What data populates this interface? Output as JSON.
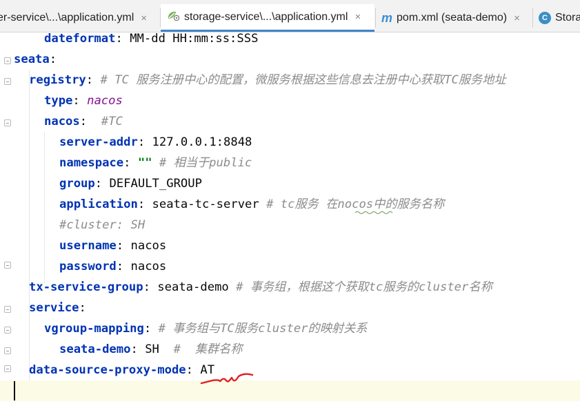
{
  "tabs": [
    {
      "label": "er-service\\...\\application.yml",
      "active": false
    },
    {
      "label": "storage-service\\...\\application.yml",
      "active": true
    },
    {
      "label": "pom.xml (seata-demo)",
      "active": false
    },
    {
      "label": "Stora",
      "active": false
    }
  ],
  "tab_icons": {
    "m_letter": "m",
    "c_letter": "C"
  },
  "close_glyph": "×",
  "lines": [
    {
      "key": "dateformat",
      "sep": ": ",
      "value": "MM-dd HH:mm:ss:SSS"
    },
    {
      "key": "seata",
      "sep": ":"
    },
    {
      "key": "registry",
      "sep": ": ",
      "comment": "# TC 服务注册中心的配置，微服务根据这些信息去注册中心获取TC服务地址"
    },
    {
      "key": "type",
      "sep": ": ",
      "value": "nacos"
    },
    {
      "key": "nacos",
      "sep": ":  ",
      "comment": "#TC"
    },
    {
      "key": "server-addr",
      "sep": ": ",
      "value": "127.0.0.1:8848"
    },
    {
      "key": "namespace",
      "sep": ": ",
      "value": "\"\"",
      "comment": " # 相当于public"
    },
    {
      "key": "group",
      "sep": ": ",
      "value": "DEFAULT_GROUP"
    },
    {
      "key": "application",
      "sep": ": ",
      "value": "seata-tc-server",
      "comment": " # tc服务 在nocos中的服务名称"
    },
    {
      "comment": "#cluster: SH"
    },
    {
      "key": "username",
      "sep": ": ",
      "value": "nacos"
    },
    {
      "key": "password",
      "sep": ": ",
      "value": "nacos"
    },
    {
      "key": "tx-service-group",
      "sep": ": ",
      "value": "seata-demo",
      "comment": " # 事务组，根据这个获取tc服务的cluster名称"
    },
    {
      "key": "service",
      "sep": ":"
    },
    {
      "key": "vgroup-mapping",
      "sep": ": ",
      "comment": "# 事务组与TC服务cluster的映射关系"
    },
    {
      "key": "seata-demo",
      "sep": ": ",
      "value": "SH",
      "comment": "  #  集群名称"
    },
    {
      "key": "data-source-proxy-mode",
      "sep": ": ",
      "value": "AT"
    }
  ],
  "colors": {
    "key": "#0033b3",
    "comment": "#8c8c8c",
    "string": "#067d17",
    "keyword": "#871094",
    "active_tab_underline": "#4083c9",
    "current_line": "#fcfbe6",
    "annotation": "#e02020"
  }
}
